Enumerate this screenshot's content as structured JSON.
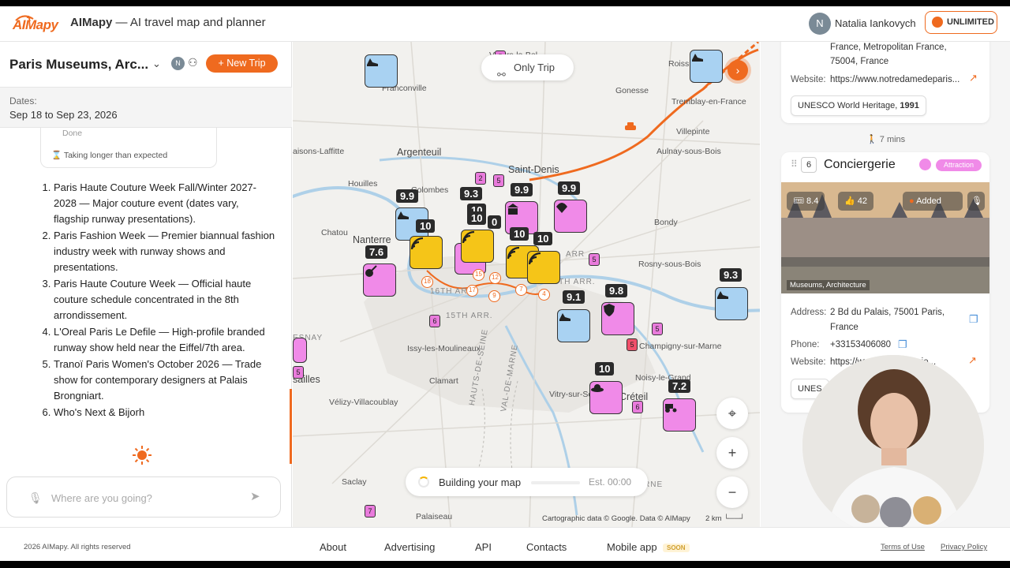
{
  "header": {
    "logo_text": "AIMapy",
    "app_name": "AIMapy",
    "app_tagline": " — AI travel map and planner",
    "user_initial": "N",
    "user_name": "Natalia Iankovych",
    "plan_label": "UNLIMITED"
  },
  "trip": {
    "title": "Paris Museums, Arc...",
    "avatar_initial": "N",
    "new_trip_label": "New Trip",
    "dates_label": "Dates:",
    "dates_value": "Sep 18 to Sep 23, 2026",
    "status_done": "Done",
    "status_slow": "Taking longer than expected",
    "events": [
      "Paris Haute Couture Week Fall/Winter 2027-2028 — Major couture event (dates vary, flagship runway presentations).",
      "Paris Fashion Week — Premier biannual fashion industry week with runway shows and presentations.",
      "Paris Haute Couture Week — Official haute couture schedule concentrated in the 8th arrondissement.",
      "L'Oreal Paris Le Defile — High-profile branded runway show held near the Eiffel/7th area.",
      "Tranoï Paris Women's October 2026 — Trade show for contemporary designers at Palais Brongniart.",
      "Who's Next & Bijorh"
    ],
    "search_placeholder": "Where are you going?"
  },
  "map": {
    "only_trip_label": "Only Trip",
    "building_label": "Building your map",
    "building_est": "Est. 00:00",
    "credits": "Cartographic data © Google. Data © AIMapy",
    "scale": "2 km",
    "places": {
      "villiers": "Villiers-le-Bel",
      "roissy": "Roiss",
      "franconville": "Franconville",
      "gonesse": "Gonesse",
      "tremblay": "Tremblay-en-France",
      "villepinte": "Villepinte",
      "argenteuil": "Argenteuil",
      "saint_denis": "Saint-Denis",
      "aulnay": "Aulnay-sous-Bois",
      "laffitte": "aisons-Laffitte",
      "houilles": "Houilles",
      "colombes": "Colombes",
      "bondy": "Bondy",
      "chatou": "Chatou",
      "nanterre": "Nanterre",
      "rosny": "Rosny-sous-Bois",
      "arr16": "16TH ARR.",
      "arr20": "20TH ARR.",
      "arr15": "15TH ARR.",
      "arr_frag": "ARR",
      "issy": "Issy-les-Moulineaux",
      "champigny": "Champigny-sur-Marne",
      "esnay": "ESNAY",
      "versailles": "sailles",
      "clamart": "Clamart",
      "noisy": "Noisy-le-Grand",
      "vitry": "Vitry-sur-Seine",
      "creteil": "Créteil",
      "hauts_de_seine": "HAUTS-DE-SEINE",
      "val_de_marne": "VAL-DE-MARNE",
      "velizy": "Vélizy-Villacoublay",
      "saclay": "Saclay",
      "palaiseau": "Palaiseau",
      "rne": "RNE"
    },
    "scores": [
      "9.9",
      "9.3",
      "10",
      "10",
      "9.9",
      "9.9",
      "10",
      "0",
      "10",
      "10",
      "7.6",
      "9.1",
      "9.8",
      "9.3",
      "10",
      "7.2"
    ],
    "pins": [
      "5",
      "2",
      "5",
      "5",
      "6",
      "5",
      "5",
      "5",
      "6",
      "7"
    ],
    "orders": [
      "18",
      "17",
      "15",
      "12",
      "9",
      "7",
      "4"
    ]
  },
  "place_top": {
    "address_tail_1": "France, Metropolitan France,",
    "address_tail_2": "75004, France",
    "website_label": "Website:",
    "website": "https://www.notredamedeparis...",
    "tag_prefix": "UNESCO World Heritage, ",
    "tag_year": "1991",
    "walk": "7 mins"
  },
  "place": {
    "number": "6",
    "name": "Conciergerie",
    "category_badge": "Attraction",
    "rating": "8.4",
    "likes": "42",
    "added_label": "Added",
    "photo_caption": "Museums, Architecture",
    "address_label": "Address:",
    "address": "2 Bd du Palais, 75001 Paris, France",
    "phone_label": "Phone:",
    "phone": "+33153406080",
    "website_label": "Website:",
    "website": "https://www.conciergerie...",
    "tag_fragment": "UNES"
  },
  "footer": {
    "copyright": "2026 AIMapy. All rights reserved",
    "about": "About",
    "advertising": "Advertising",
    "api": "API",
    "contacts": "Contacts",
    "mobile": "Mobile app",
    "soon": "SOON",
    "terms": "Terms of Use",
    "privacy": "Privacy Policy"
  },
  "colors": {
    "accent": "#ef6a1f",
    "museum_marker": "#f08ae8",
    "shopping_marker": "#a9d2f2",
    "highlight_marker": "#f5c518"
  }
}
